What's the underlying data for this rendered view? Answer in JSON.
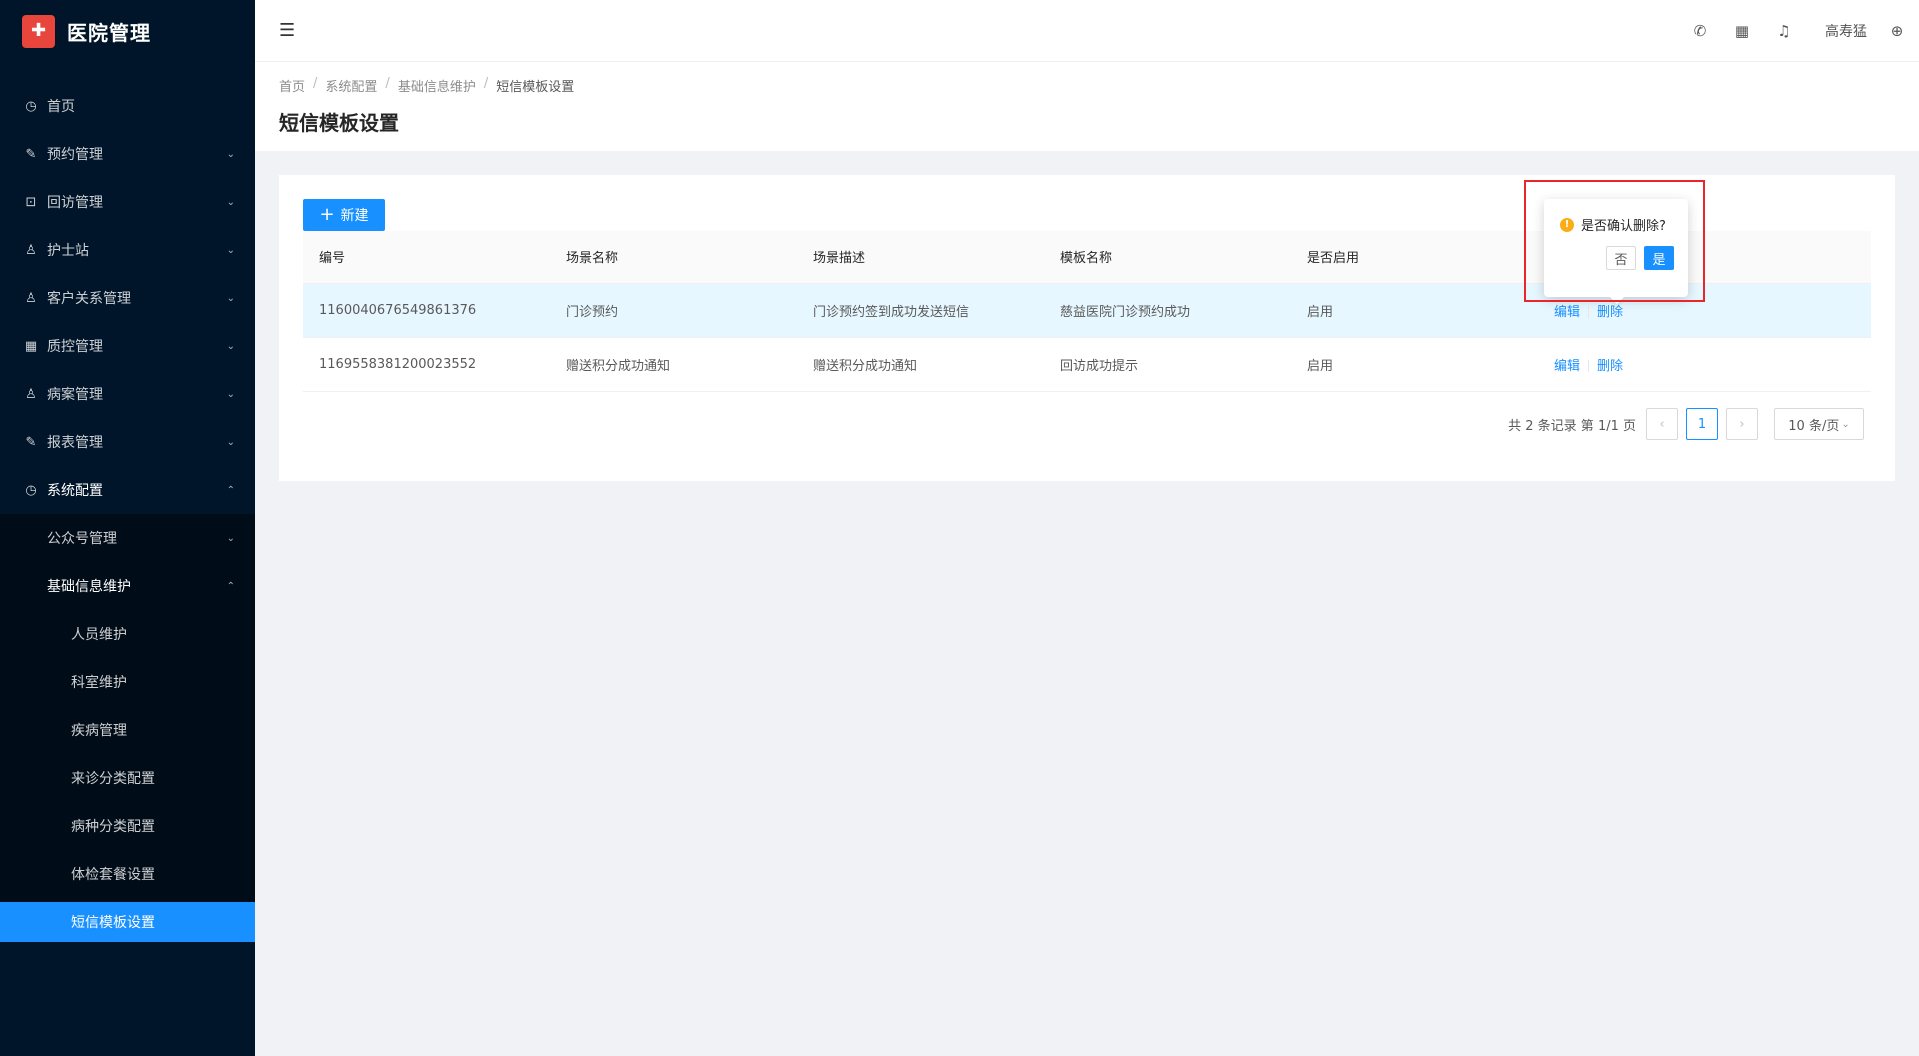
{
  "app": {
    "title": "医院管理"
  },
  "sidebar": {
    "items": [
      {
        "label": "首页",
        "icon": "dashboard-icon"
      },
      {
        "label": "预约管理",
        "icon": "edit-icon"
      },
      {
        "label": "回访管理",
        "icon": "lock-icon"
      },
      {
        "label": "护士站",
        "icon": "user-icon"
      },
      {
        "label": "客户关系管理",
        "icon": "user-icon"
      },
      {
        "label": "质控管理",
        "icon": "table-icon"
      },
      {
        "label": "病案管理",
        "icon": "user-icon"
      },
      {
        "label": "报表管理",
        "icon": "edit-icon"
      },
      {
        "label": "系统配置",
        "icon": "dashboard-icon"
      }
    ],
    "sub": {
      "public_account": "公众号管理",
      "basic_info": "基础信息维护"
    },
    "leaves": [
      "人员维护",
      "科室维护",
      "疾病管理",
      "来诊分类配置",
      "病种分类配置",
      "体检套餐设置",
      "短信模板设置"
    ]
  },
  "header": {
    "user": "高寿猛"
  },
  "breadcrumb": [
    "首页",
    "系统配置",
    "基础信息维护",
    "短信模板设置"
  ],
  "page": {
    "title": "短信模板设置",
    "new_button": "新建"
  },
  "table": {
    "columns": [
      "编号",
      "场景名称",
      "场景描述",
      "模板名称",
      "是否启用",
      ""
    ],
    "rows": [
      {
        "id": "1160040676549861376",
        "scene": "门诊预约",
        "desc": "门诊预约签到成功发送短信",
        "template": "慈益医院门诊预约成功",
        "enabled": "启用"
      },
      {
        "id": "1169558381200023552",
        "scene": "赠送积分成功通知",
        "desc": "赠送积分成功通知",
        "template": "回访成功提示",
        "enabled": "启用"
      }
    ],
    "edit_label": "编辑",
    "delete_label": "删除"
  },
  "pagination": {
    "summary": "共 2 条记录 第 1/1 页",
    "current": "1",
    "page_size": "10 条/页"
  },
  "popconfirm": {
    "message": "是否确认删除?",
    "cancel": "否",
    "ok": "是"
  }
}
